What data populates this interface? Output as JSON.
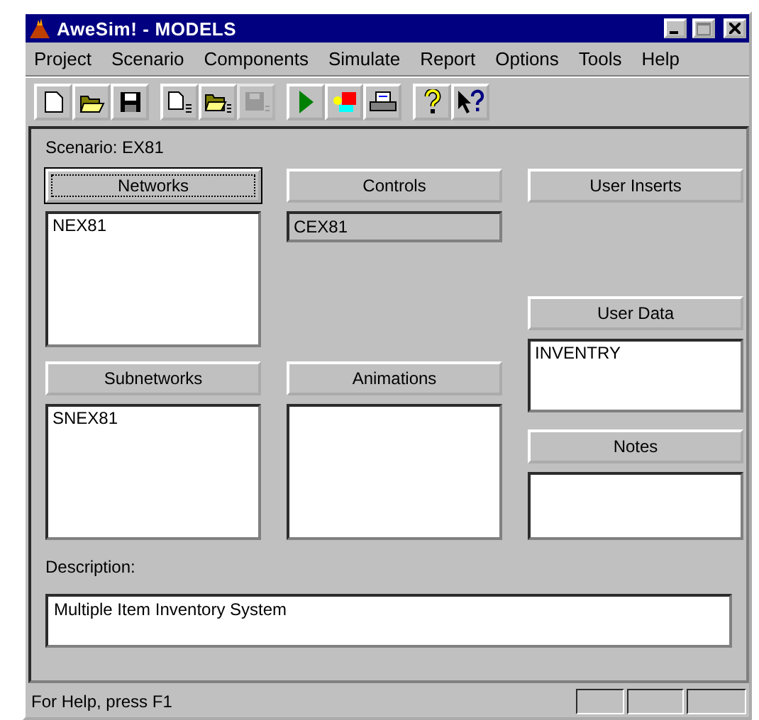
{
  "window": {
    "title": "AweSim! - MODELS"
  },
  "menu": [
    {
      "label": "Project"
    },
    {
      "label": "Scenario"
    },
    {
      "label": "Components"
    },
    {
      "label": "Simulate"
    },
    {
      "label": "Report"
    },
    {
      "label": "Options"
    },
    {
      "label": "Tools"
    },
    {
      "label": "Help"
    }
  ],
  "toolbar": [
    [
      {
        "kind": "new"
      },
      {
        "kind": "open"
      },
      {
        "kind": "save"
      }
    ],
    [
      {
        "kind": "new-s"
      },
      {
        "kind": "open-s"
      },
      {
        "kind": "save-s",
        "disabled": true
      }
    ],
    [
      {
        "kind": "run"
      },
      {
        "kind": "colors"
      },
      {
        "kind": "print"
      }
    ],
    [
      {
        "kind": "help"
      },
      {
        "kind": "context-help"
      }
    ]
  ],
  "scenario_label": "Scenario: EX81",
  "networks": {
    "button": "Networks",
    "focused": true,
    "items": [
      "NEX81"
    ]
  },
  "subnetworks": {
    "button": "Subnetworks",
    "focused": false,
    "items": [
      "SNEX81"
    ]
  },
  "controls": {
    "button": "Controls",
    "focused": false,
    "value": "CEX81"
  },
  "animations": {
    "button": "Animations",
    "focused": false
  },
  "user_inserts": {
    "button": "User Inserts",
    "focused": false
  },
  "user_data": {
    "button": "User Data",
    "focused": false,
    "items": [
      "INVENTRY"
    ]
  },
  "notes": {
    "button": "Notes",
    "focused": false
  },
  "description": {
    "label": "Description:",
    "value": "Multiple Item Inventory System"
  },
  "status_bar": {
    "text": "For Help, press F1"
  }
}
